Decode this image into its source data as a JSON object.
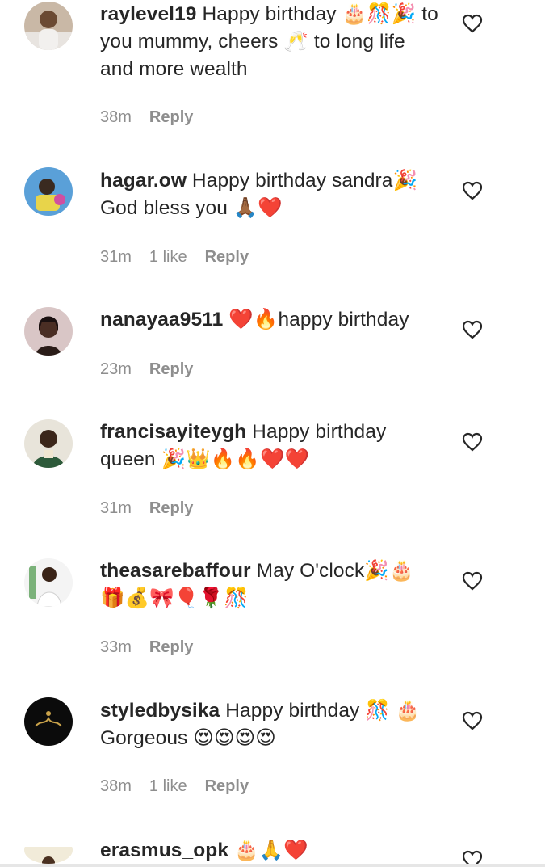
{
  "comments": [
    {
      "username": "raylevel19",
      "text": "Happy birthday 🎂🎊🎉 to you mummy, cheers 🥂 to long life and more wealth",
      "time": "38m",
      "likes": "",
      "reply": "Reply"
    },
    {
      "username": "hagar.ow",
      "text": "Happy birthday sandra🎉 God bless you 🙏🏾❤️",
      "time": "31m",
      "likes": "1 like",
      "reply": "Reply"
    },
    {
      "username": "nanayaa9511",
      "text": "❤️🔥happy birthday",
      "time": "23m",
      "likes": "",
      "reply": "Reply"
    },
    {
      "username": "francisayiteygh",
      "text": "Happy birthday queen 🎉👑🔥🔥❤️❤️",
      "time": "31m",
      "likes": "",
      "reply": "Reply"
    },
    {
      "username": "theasarebaffour",
      "text": "May O'clock🎉🎂 🎁💰🎀🎈🌹🎊",
      "time": "33m",
      "likes": "",
      "reply": "Reply"
    },
    {
      "username": "styledbysika",
      "text": "Happy birthday 🎊 🎂 Gorgeous 😍😍😍😍",
      "time": "38m",
      "likes": "1 like",
      "reply": "Reply"
    },
    {
      "username": "erasmus_opk",
      "text": "🎂🙏❤️",
      "time": "",
      "likes": "",
      "reply": ""
    }
  ],
  "icons": {
    "like": "heart-outline-icon",
    "avatar": "profile-avatar"
  },
  "colors": {
    "meta": "#8e8e8e",
    "text": "#262626"
  }
}
